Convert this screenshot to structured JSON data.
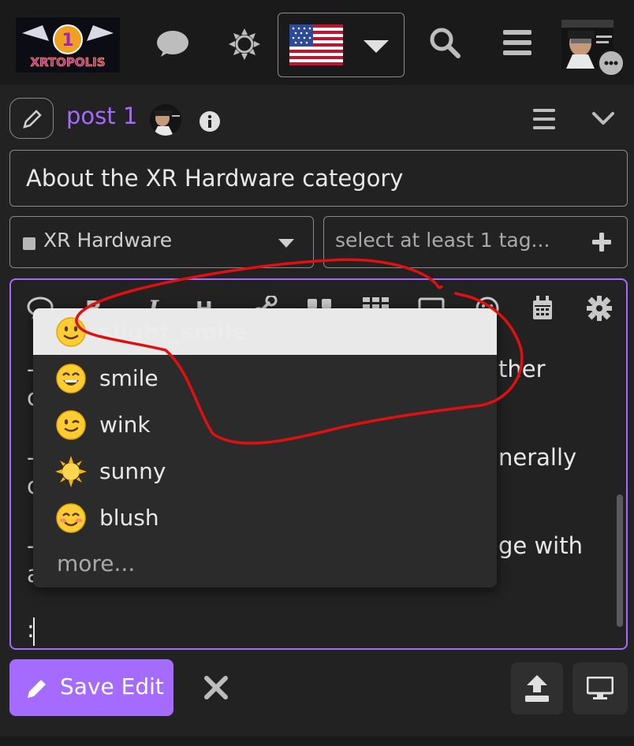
{
  "header": {
    "logo_text": "XRTOPOLIS",
    "logo_badge": "1",
    "icons": [
      "chat-icon",
      "sun-icon",
      "us-flag-icon",
      "caret-down-icon",
      "search-icon",
      "hamburger-icon",
      "user-avatar",
      "chat-bubble-icon"
    ]
  },
  "composer": {
    "post_label": "post 1",
    "title_value": "About the XR Hardware category",
    "category": {
      "label": "XR Hardware",
      "swatch_color": "#b7b7b7"
    },
    "tags": {
      "placeholder": "select at least 1 tag..."
    }
  },
  "editor": {
    "toolbar_icons": [
      "quote-icon",
      "bold-icon",
      "italic-icon",
      "heading-icon",
      "link-icon",
      "blockquote-icon",
      "grid-icon",
      "image-icon",
      "emoji-icon",
      "calendar-icon",
      "gear-icon"
    ],
    "lines": {
      "line1_right": "ther",
      "line2_right": "nerally",
      "line3_right": "ge with",
      "line3_left_tail": "a",
      "colon": ":"
    }
  },
  "autocomplete": {
    "items": [
      {
        "label": "slight_smile",
        "emoji": "slight-smile-emoji",
        "selected": true
      },
      {
        "label": "smile",
        "emoji": "smile-emoji",
        "selected": false
      },
      {
        "label": "wink",
        "emoji": "wink-emoji",
        "selected": false
      },
      {
        "label": "sunny",
        "emoji": "sunny-emoji",
        "selected": false
      },
      {
        "label": "blush",
        "emoji": "blush-emoji",
        "selected": false
      }
    ],
    "more_label": "more..."
  },
  "footer": {
    "save_label": "Save Edit"
  },
  "colors": {
    "accent": "#a56bff",
    "background": "#222222",
    "header_bg": "#1a1a1a",
    "annotation": "#e01010"
  }
}
